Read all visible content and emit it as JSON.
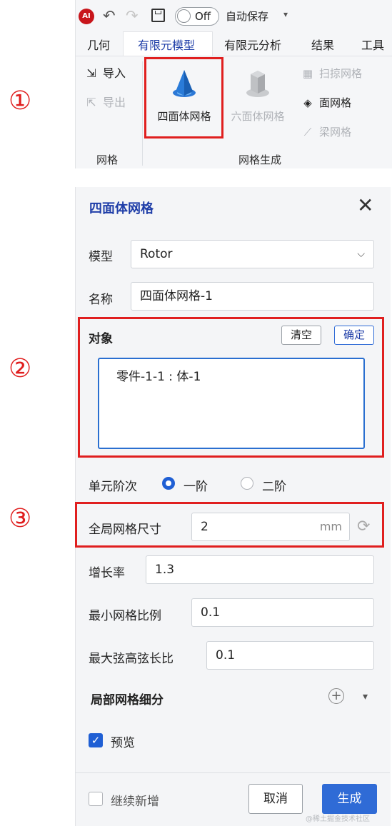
{
  "ribbon": {
    "autosave_toggle": "Off",
    "autosave_label": "自动保存",
    "tabs": [
      {
        "label": "几何"
      },
      {
        "label": "有限元模型"
      },
      {
        "label": "有限元分析"
      },
      {
        "label": "结果"
      },
      {
        "label": "工具"
      }
    ],
    "active_tab": "有限元模型",
    "groups": {
      "mesh": {
        "label": "网格",
        "import_label": "导入",
        "export_label": "导出"
      },
      "mesh_gen": {
        "label": "网格生成",
        "tet_label": "四面体网格",
        "hex_label": "六面体网格",
        "sweep_label": "扫掠网格",
        "surface_label": "面网格",
        "beam_label": "梁网格"
      }
    }
  },
  "annotations": {
    "step1": "①",
    "step2": "②",
    "step3": "③"
  },
  "panel": {
    "title": "四面体网格",
    "model_label": "模型",
    "model_value": "Rotor",
    "name_label": "名称",
    "name_value": "四面体网格-1",
    "object_label": "对象",
    "clear_label": "清空",
    "confirm_label": "确定",
    "object_item": "零件-1-1 : 体-1",
    "order_label": "单元阶次",
    "order_first": "一阶",
    "order_second": "二阶",
    "global_size_label": "全局网格尺寸",
    "global_size_value": "2",
    "global_size_unit": "mm",
    "growth_label": "增长率",
    "growth_value": "1.3",
    "min_ratio_label": "最小网格比例",
    "min_ratio_value": "0.1",
    "max_chord_label": "最大弦高弦长比",
    "max_chord_value": "0.1",
    "local_refine_label": "局部网格细分",
    "preview_label": "预览",
    "continue_label": "继续新增",
    "cancel_label": "取消",
    "generate_label": "生成"
  },
  "watermark": "@稀土掘金技术社区",
  "colors": {
    "accent": "#1f3ea8",
    "primary_button": "#2f6bd6",
    "highlight": "#e01f1f"
  }
}
